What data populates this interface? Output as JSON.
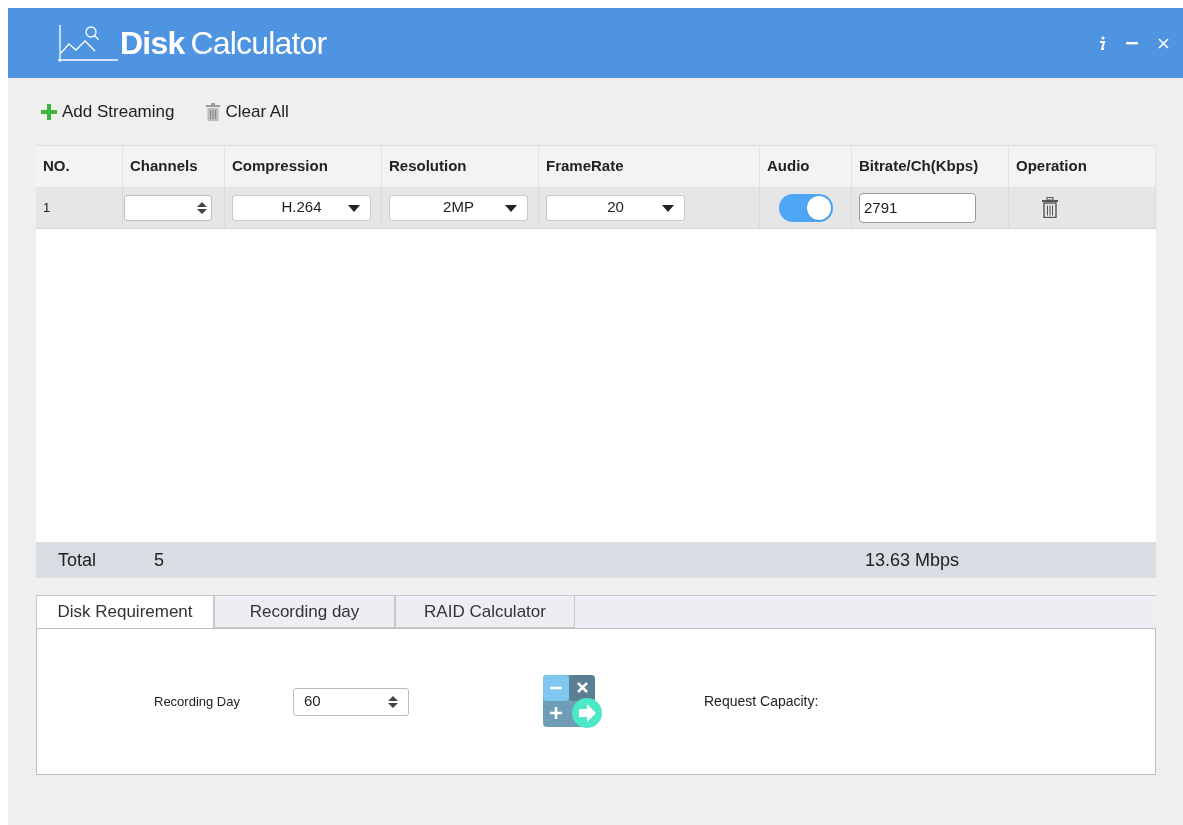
{
  "window": {
    "title_bold": "Disk",
    "title_rest": "Calculator"
  },
  "toolbar": [
    {
      "kind": "add",
      "label": "Add Streaming"
    },
    {
      "kind": "clear",
      "label": "Clear All"
    }
  ],
  "table": {
    "columns": [
      "NO.",
      "Channels",
      "Compression",
      "Resolution",
      "FrameRate",
      "Audio",
      "Bitrate/Ch(Kbps)",
      "Operation"
    ],
    "rows": [
      {
        "no": "1",
        "compression": "H.264",
        "resolution": "2MP",
        "frame_rate": "20",
        "audio_on": true,
        "bitrate": "2791"
      }
    ]
  },
  "total": {
    "label": "Total",
    "channels": "5",
    "bitrate": "13.63 Mbps"
  },
  "tabs": [
    {
      "label": "Disk Requirement",
      "selected": true
    },
    {
      "label": "Recording day",
      "selected": false
    },
    {
      "label": "RAID Calculator",
      "selected": false
    }
  ],
  "panel": {
    "recording_day_label": "Recording Day",
    "recording_day_value": "60",
    "request_capacity_label": "Request Capacity:"
  }
}
